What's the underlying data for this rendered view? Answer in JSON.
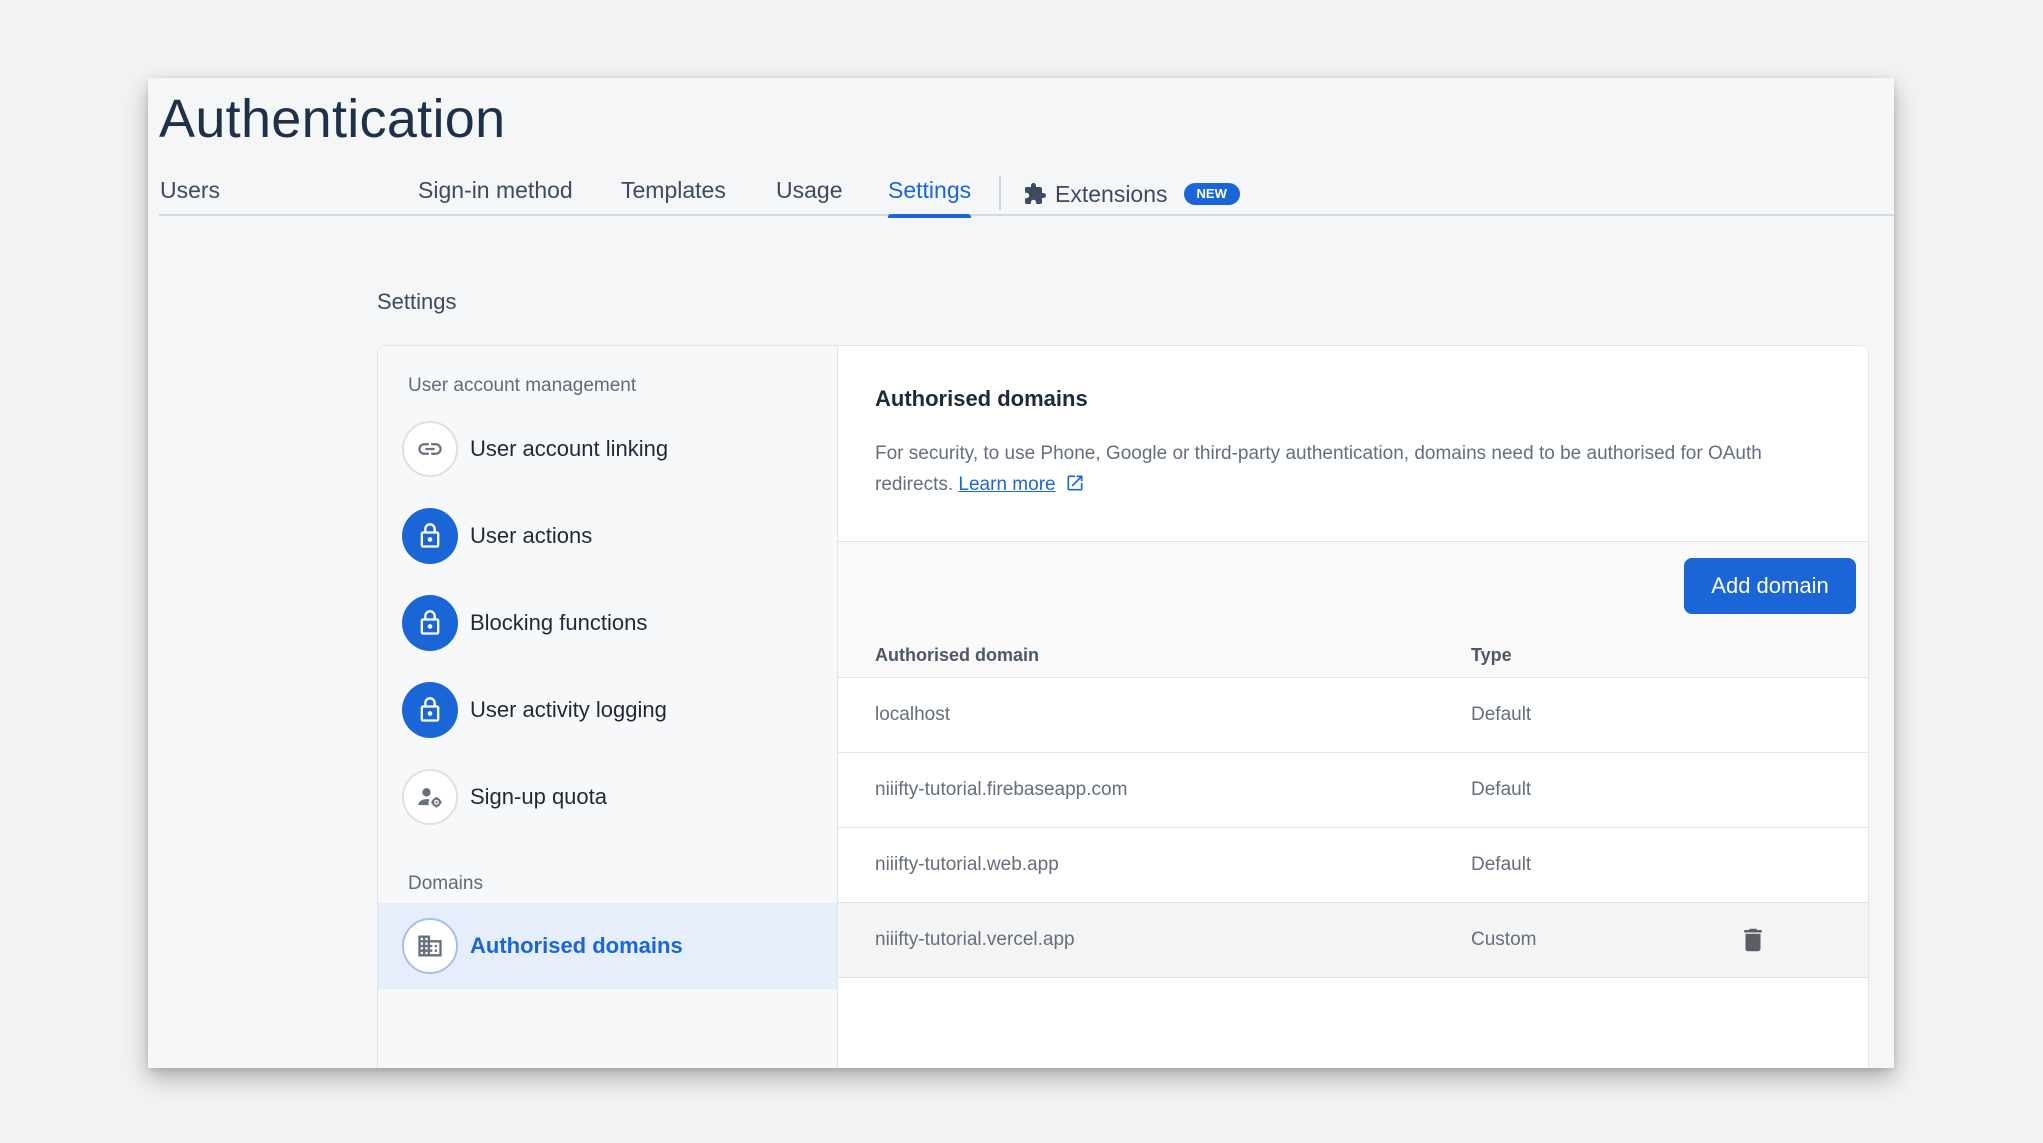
{
  "page": {
    "title": "Authentication"
  },
  "tabs": [
    {
      "label": "Users"
    },
    {
      "label": "Sign-in method"
    },
    {
      "label": "Templates"
    },
    {
      "label": "Usage"
    },
    {
      "label": "Settings",
      "active": true
    }
  ],
  "extensions_tab": {
    "label": "Extensions",
    "badge": "NEW"
  },
  "settings": {
    "title": "Settings"
  },
  "sidebar": {
    "group1_label": "User account management",
    "items": [
      {
        "label": "User account linking",
        "icon": "link-icon"
      },
      {
        "label": "User actions",
        "icon": "lock-icon"
      },
      {
        "label": "Blocking functions",
        "icon": "lock-icon"
      },
      {
        "label": "User activity logging",
        "icon": "lock-icon"
      },
      {
        "label": "Sign-up quota",
        "icon": "user-settings-icon"
      }
    ],
    "group2_label": "Domains",
    "domains_item": {
      "label": "Authorised domains",
      "icon": "building-icon",
      "selected": true
    }
  },
  "panel": {
    "title": "Authorised domains",
    "description": "For security, to use Phone, Google or third-party authentication, domains need to be authorised for OAuth redirects.",
    "learn_more": "Learn more",
    "add_button": "Add domain",
    "columns": {
      "domain": "Authorised domain",
      "type": "Type"
    },
    "rows": [
      {
        "domain": "localhost",
        "type": "Default"
      },
      {
        "domain": "niiifty-tutorial.firebaseapp.com",
        "type": "Default"
      },
      {
        "domain": "niiifty-tutorial.web.app",
        "type": "Default"
      },
      {
        "domain": "niiifty-tutorial.vercel.app",
        "type": "Custom",
        "deletable": true
      }
    ]
  },
  "colors": {
    "accent": "#1a66d6",
    "title": "#1e3149",
    "background": "#f5f6f7"
  }
}
